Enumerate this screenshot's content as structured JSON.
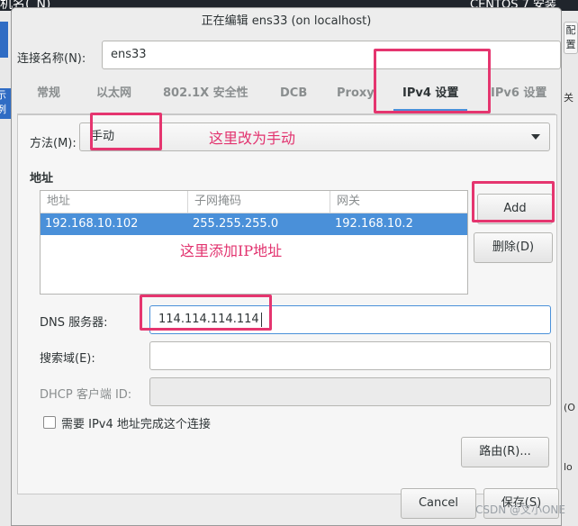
{
  "background": {
    "top_left_text": "机名(_N)",
    "top_right_text": "CENTOS 7 安装",
    "left_fragment": "示例",
    "left_fragment2": "Co",
    "right_button_fragment": "配置",
    "right_fragments": [
      "关",
      "(O",
      "lo"
    ]
  },
  "dialog": {
    "title": "正在编辑 ens33 (on localhost)",
    "connection_name_label": "连接名称(N):",
    "connection_name_value": "ens33",
    "tabs": [
      "常规",
      "以太网",
      "802.1X 安全性",
      "DCB",
      "Proxy",
      "IPv4 设置",
      "IPv6 设置"
    ],
    "active_tab": "IPv4 设置",
    "method_label": "方法(M):",
    "method_value": "手动",
    "address_heading": "地址",
    "address_columns": [
      "地址",
      "子网掩码",
      "网关"
    ],
    "address_rows": [
      [
        "192.168.10.102",
        "255.255.255.0",
        "192.168.10.2"
      ]
    ],
    "add_button": "Add",
    "delete_button": "删除(D)",
    "dns_label": "DNS 服务器:",
    "dns_value": "114.114.114.114",
    "search_domain_label": "搜索域(E):",
    "search_domain_value": "",
    "dhcp_client_id_label": "DHCP 客户端 ID:",
    "dhcp_client_id_value": "",
    "require_ipv4_label": "需要 IPv4 地址完成这个连接",
    "require_ipv4_checked": false,
    "routes_button": "路由(R)...",
    "cancel_button": "Cancel",
    "save_button": "保存(S)"
  },
  "annotations": {
    "method_note": "这里改为手动",
    "address_note": "这里添加IP地址",
    "color": "#e5356f"
  },
  "accent_color": "#4a90d9",
  "watermark": "CSDN @叉小ONE"
}
